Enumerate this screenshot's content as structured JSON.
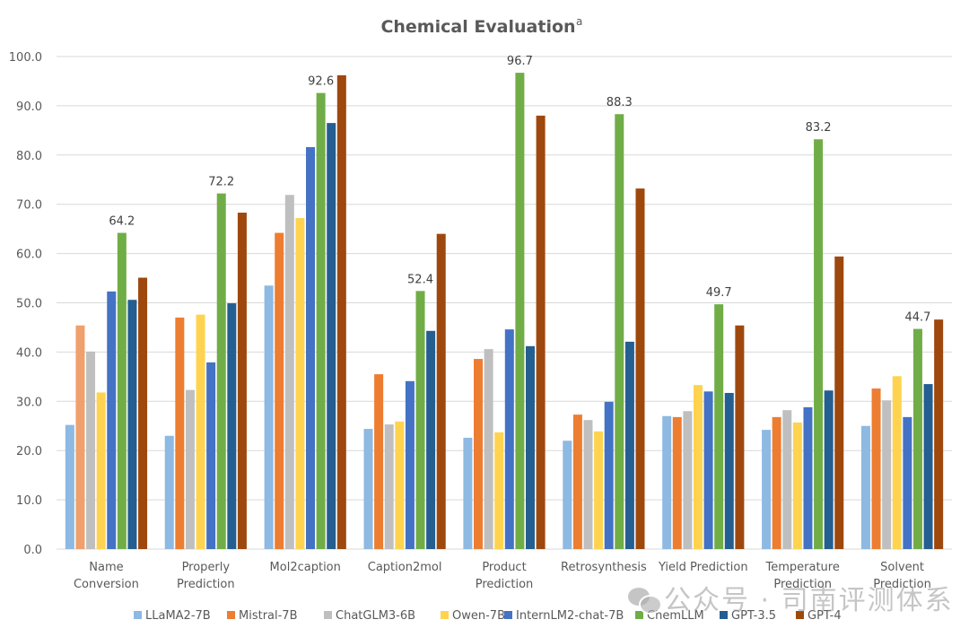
{
  "chart_data": {
    "type": "bar",
    "title": "Chemical Evaluation",
    "title_superscript": "a",
    "xlabel": "",
    "ylabel": "",
    "ylim": [
      0,
      100
    ],
    "yticks": [
      "0.0",
      "10.0",
      "20.0",
      "30.0",
      "40.0",
      "50.0",
      "60.0",
      "70.0",
      "80.0",
      "90.0",
      "100.0"
    ],
    "grid": true,
    "legend_position": "bottom",
    "categories": [
      [
        "Name",
        "Conversion"
      ],
      [
        "Properly",
        "Prediction"
      ],
      [
        "Mol2caption"
      ],
      [
        "Caption2mol"
      ],
      [
        "Product",
        "Prediction"
      ],
      [
        "Retrosynthesis"
      ],
      [
        "Yield Prediction"
      ],
      [
        "Temperature",
        "Prediction"
      ],
      [
        "Solvent",
        "Prediction"
      ]
    ],
    "series": [
      {
        "name": "LLaMA2-7B",
        "color": "#8db9e2",
        "values": [
          25.2,
          23.0,
          53.5,
          24.4,
          22.6,
          22.0,
          27.0,
          24.2,
          25.0
        ]
      },
      {
        "name": "Mistral-7B",
        "color": "#ed7d31",
        "values": [
          45.4,
          47.0,
          64.2,
          35.5,
          38.6,
          27.3,
          26.8,
          26.8,
          32.6
        ]
      },
      {
        "name": "ChatGLM3-6B",
        "color": "#bfbfbf",
        "values": [
          40.1,
          32.3,
          71.9,
          25.3,
          40.6,
          26.2,
          28.0,
          28.2,
          30.2
        ]
      },
      {
        "name": "Owen-7B",
        "color": "#ffd34f",
        "values": [
          31.8,
          47.6,
          67.2,
          25.9,
          23.7,
          23.9,
          33.3,
          25.7,
          35.1
        ]
      },
      {
        "name": "InternLM2-chat-7B",
        "color": "#4472c4",
        "values": [
          52.3,
          37.9,
          81.6,
          34.1,
          44.6,
          29.9,
          32.0,
          28.8,
          26.8
        ]
      },
      {
        "name": "ChemLLM",
        "color": "#70ad47",
        "values": [
          64.2,
          72.2,
          92.6,
          52.4,
          96.7,
          88.3,
          49.7,
          83.2,
          44.7
        ]
      },
      {
        "name": "GPT-3.5",
        "color": "#255e91",
        "values": [
          50.6,
          49.9,
          86.5,
          44.3,
          41.2,
          42.1,
          31.7,
          32.2,
          33.5
        ]
      },
      {
        "name": "GPT-4",
        "color": "#9e480e",
        "values": [
          55.1,
          68.3,
          96.2,
          64.0,
          88.0,
          73.2,
          45.4,
          59.4,
          46.6
        ]
      }
    ],
    "first_bar_color_override": "#f0a06c",
    "data_labels": {
      "series": "ChemLLM",
      "labels": [
        "64.2",
        "72.2",
        "92.6",
        "52.4",
        "96.7",
        "88.3",
        "49.7",
        "83.2",
        "44.7"
      ]
    }
  },
  "watermark": {
    "text": "公众号 · 司南评测体系",
    "icon": "wechat-icon"
  }
}
